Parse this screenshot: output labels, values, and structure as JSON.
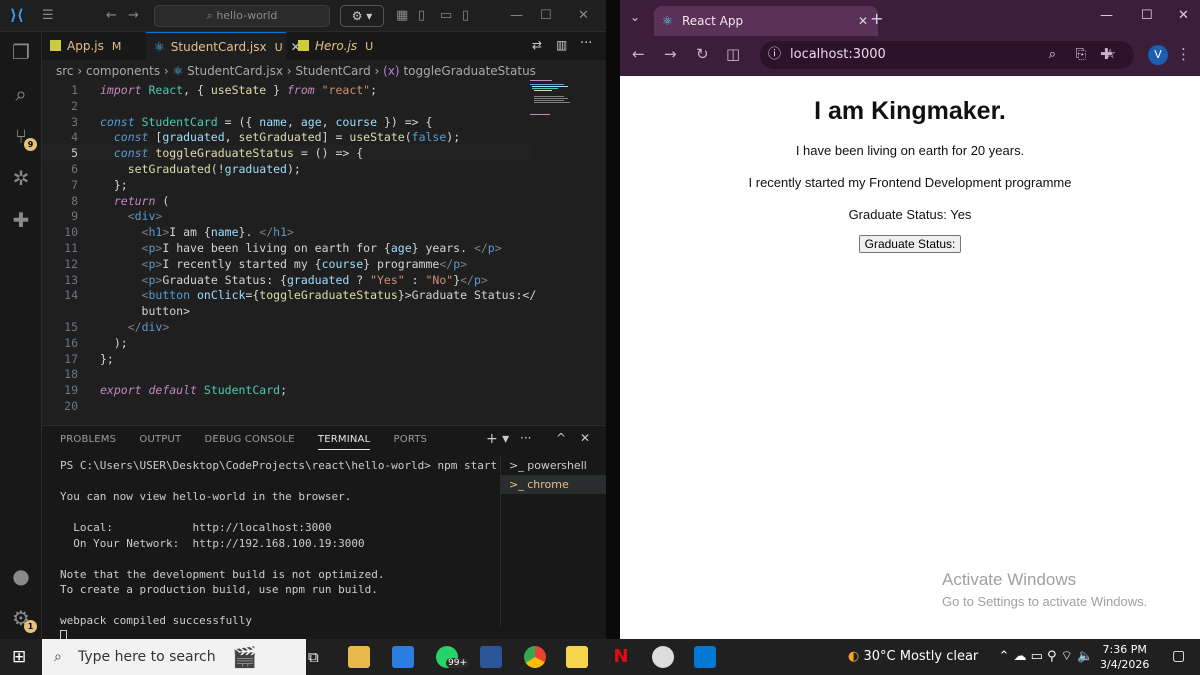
{
  "vscode": {
    "title_search": "hello-world",
    "tabs": [
      {
        "name": "App.js",
        "status": "M"
      },
      {
        "name": "StudentCard.jsx",
        "status": "U"
      },
      {
        "name": "Hero.js",
        "status": "U"
      }
    ],
    "breadcrumb": [
      "src",
      "components",
      "StudentCard.jsx",
      "StudentCard",
      "toggleGraduateStatus"
    ],
    "badges": {
      "source_control": "9",
      "manage": "1"
    },
    "code": [
      {
        "n": "1",
        "t": "import React, { useState } from \"react\";"
      },
      {
        "n": "2",
        "t": ""
      },
      {
        "n": "3",
        "t": "const StudentCard = ({ name, age, course }) => {"
      },
      {
        "n": "4",
        "t": "  const [graduated, setGraduated] = useState(false);"
      },
      {
        "n": "5",
        "t": "  const toggleGraduateStatus = () => {"
      },
      {
        "n": "6",
        "t": "    setGraduated(!graduated);"
      },
      {
        "n": "7",
        "t": "  };"
      },
      {
        "n": "8",
        "t": "  return ("
      },
      {
        "n": "9",
        "t": "    <div>"
      },
      {
        "n": "10",
        "t": "      <h1>I am {name}. </h1>"
      },
      {
        "n": "11",
        "t": "      <p>I have been living on earth for {age} years. </p>"
      },
      {
        "n": "12",
        "t": "      <p>I recently started my {course} programme</p>"
      },
      {
        "n": "13",
        "t": "      <p>Graduate Status: {graduated ? \"Yes\" : \"No\"}</p>"
      },
      {
        "n": "14",
        "t": "      <button onClick={toggleGraduateStatus}>Graduate Status:</"
      },
      {
        "n": "",
        "t": "      button>"
      },
      {
        "n": "15",
        "t": "    </div>"
      },
      {
        "n": "16",
        "t": "  );"
      },
      {
        "n": "17",
        "t": "};"
      },
      {
        "n": "18",
        "t": ""
      },
      {
        "n": "19",
        "t": "export default StudentCard;"
      },
      {
        "n": "20",
        "t": ""
      }
    ],
    "panel_tabs": [
      "PROBLEMS",
      "OUTPUT",
      "DEBUG CONSOLE",
      "TERMINAL",
      "PORTS"
    ],
    "terminal_lines": [
      "PS C:\\Users\\USER\\Desktop\\CodeProjects\\react\\hello-world> npm start",
      "",
      "You can now view hello-world in the browser.",
      "",
      "  Local:            http://localhost:3000",
      "  On Your Network:  http://192.168.100.19:3000",
      "",
      "Note that the development build is not optimized.",
      "To create a production build, use npm run build.",
      "",
      "webpack compiled successfully"
    ],
    "terminal_list": [
      "powershell",
      "chrome"
    ]
  },
  "chrome": {
    "tab_title": "React App",
    "url": "localhost:3000",
    "profile": "V",
    "page": {
      "heading": "I am Kingmaker.",
      "line1": "I have been living on earth for 20 years.",
      "line2": "I recently started my Frontend Development programme",
      "line3": "Graduate Status: Yes",
      "button": "Graduate Status:"
    },
    "watermark": {
      "title": "Activate Windows",
      "sub": "Go to Settings to activate Windows."
    }
  },
  "taskbar": {
    "search_placeholder": "Type here to search",
    "whatsapp_badge": "99+",
    "weather": "30°C  Mostly clear",
    "time": "7:36 PM",
    "date": "3/4/2026"
  }
}
